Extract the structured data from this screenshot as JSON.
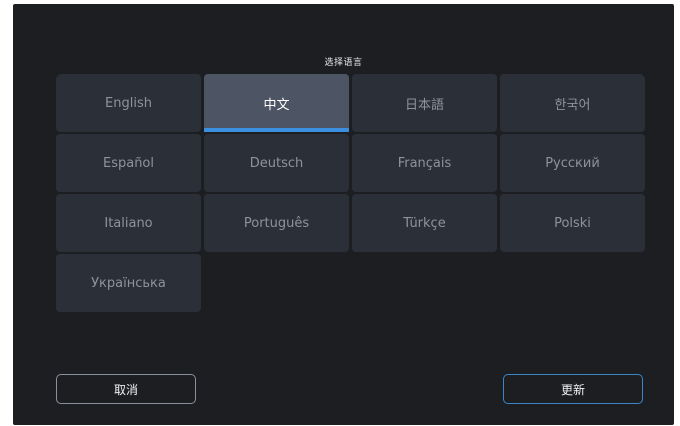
{
  "dialog": {
    "title": "选择语言"
  },
  "languages": [
    {
      "label": "English",
      "selected": false
    },
    {
      "label": "中文",
      "selected": true
    },
    {
      "label": "日本語",
      "selected": false
    },
    {
      "label": "한국어",
      "selected": false
    },
    {
      "label": "Español",
      "selected": false
    },
    {
      "label": "Deutsch",
      "selected": false
    },
    {
      "label": "Français",
      "selected": false
    },
    {
      "label": "Русский",
      "selected": false
    },
    {
      "label": "Italiano",
      "selected": false
    },
    {
      "label": "Português",
      "selected": false
    },
    {
      "label": "Türkçe",
      "selected": false
    },
    {
      "label": "Polski",
      "selected": false
    },
    {
      "label": "Українська",
      "selected": false
    }
  ],
  "buttons": {
    "cancel_label": "取消",
    "update_label": "更新"
  },
  "colors": {
    "background": "#1c1e22",
    "tile": "#2b3038",
    "tile_selected": "#4d5565",
    "accent": "#3c8ee0"
  }
}
